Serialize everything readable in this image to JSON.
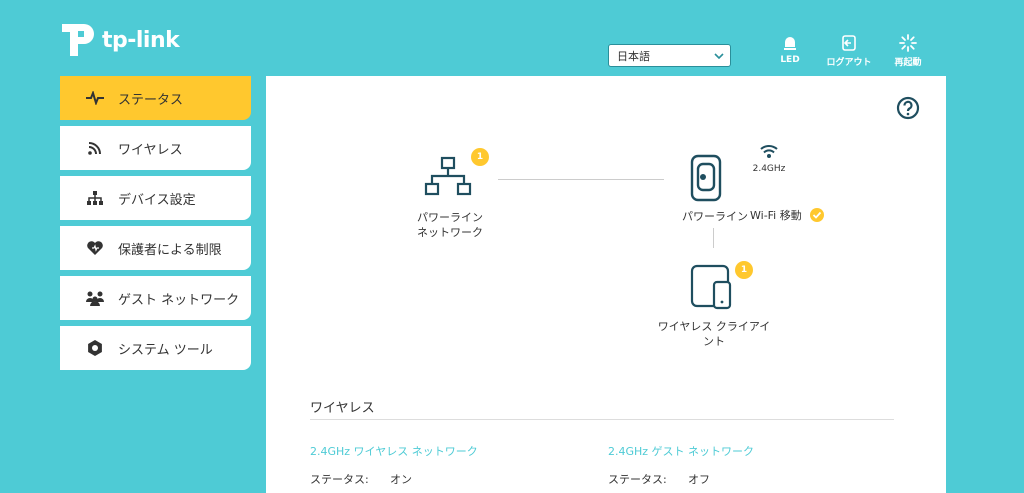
{
  "header": {
    "brand": "tp-link",
    "language": "日本語",
    "buttons": [
      {
        "label": "LED",
        "icon": "bulb-icon"
      },
      {
        "label": "ログアウト",
        "icon": "logout-icon"
      },
      {
        "label": "再起動",
        "icon": "reboot-icon"
      }
    ]
  },
  "sidebar": {
    "items": [
      {
        "label": "ステータス",
        "icon": "pulse-icon",
        "active": true
      },
      {
        "label": "ワイヤレス",
        "icon": "wifi-icon"
      },
      {
        "label": "デバイス設定",
        "icon": "network-icon"
      },
      {
        "label": "保護者による制限",
        "icon": "heart-icon"
      },
      {
        "label": "ゲスト ネットワーク",
        "icon": "guest-icon"
      },
      {
        "label": "システム ツール",
        "icon": "gear-icon"
      }
    ]
  },
  "topology": {
    "powerline_network": {
      "label_line1": "パワーライン",
      "label_line2": "ネットワーク",
      "badge": "1"
    },
    "device": {
      "label": "パワーライン",
      "band": "2.4GHz"
    },
    "wifi_move": {
      "label": "Wi-Fi 移動"
    },
    "wireless_client": {
      "label_line1": "ワイヤレス クライアイ",
      "label_line2": "ント",
      "badge": "1"
    }
  },
  "wireless": {
    "section_title": "ワイヤレス",
    "main_network": {
      "title": "2.4GHz ワイヤレス ネットワーク",
      "status_key": "ステータス:",
      "status_value": "オン"
    },
    "guest_network": {
      "title": "2.4GHz ゲスト ネットワーク",
      "status_key": "ステータス:",
      "status_value": "オフ"
    }
  },
  "colors": {
    "accent": "#4ecbd5",
    "active": "#ffc82e",
    "icon": "#1f4e5f"
  }
}
